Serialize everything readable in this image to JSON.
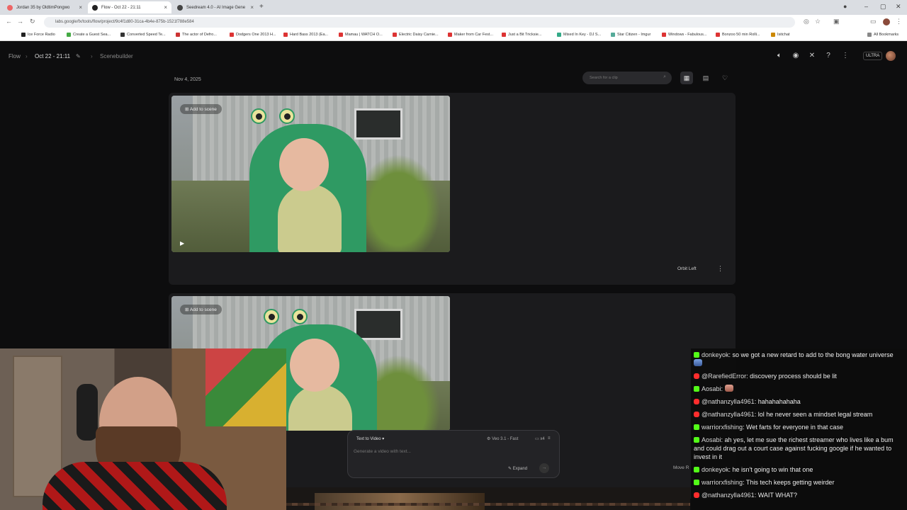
{
  "browser": {
    "tabs": [
      {
        "label": "Jordan 35 by OldtimPongwo"
      },
      {
        "label": "Flow - Oct 22 - 21:11"
      },
      {
        "label": "Seedream 4.0 - AI Image Gene"
      }
    ],
    "url": "labs.google/fx/tools/flow/project/9c4f1d80-31ca-4b4e-875b-1521f788e584",
    "bookmarks": [
      "Ice Force Radio",
      "Create a Guest Sea...",
      "Converted Speed Te...",
      "The actor of Defro...",
      "Dodgers One 2013 H...",
      "Hard Bass 2013 (Ea...",
      "Mamau | WATCH O...",
      "Electric Daisy Carnie...",
      "Maker from Car Fest...",
      "Just a Bit Tricksie...",
      "Mixed In Key - DJ S...",
      "Star Citizen - Imgur",
      "Windows - Fabulous...",
      "Bonzoo 50 min Rolli...",
      "Isitchat",
      "All Bookmarks"
    ]
  },
  "app": {
    "breadcrumb": {
      "root": "Flow",
      "project": "Oct 22 - 21:11",
      "page": "Scenebuilder"
    },
    "badge": "ULTRA",
    "date": "Nov 4, 2025",
    "search_placeholder": "Search for a clip",
    "icons": [
      "volume-icon",
      "discord-icon",
      "x-icon",
      "help-icon",
      "more-vert-icon",
      "grid-view-icon",
      "list-view-icon",
      "favorites-icon"
    ]
  },
  "clips": [
    {
      "add_label": "Add to scene",
      "label": "Orbit Left"
    },
    {
      "add_label": "Add to scene",
      "label": "Move R"
    }
  ],
  "prompt": {
    "mode": "Text to Video",
    "model": "Veo 3.1 - Fast",
    "count": "x4",
    "placeholder": "Generate a video with text...",
    "expand_label": "Expand"
  },
  "chat": {
    "messages": [
      {
        "platform": "kick",
        "user": "donkeyok",
        "text": "so we got a new retard to add to the bong water universe",
        "emote": true
      },
      {
        "platform": "youtube",
        "user": "@RarefiedError",
        "text": "discovery process should be lit"
      },
      {
        "platform": "kick",
        "user": "Aosabi",
        "text": "",
        "emote": true
      },
      {
        "platform": "youtube",
        "user": "@nathanzylla4961",
        "text": "hahahahahaha"
      },
      {
        "platform": "youtube",
        "user": "@nathanzylla4961",
        "text": "lol he never seen a mindset legal stream"
      },
      {
        "platform": "kick",
        "user": "warriorxfishing",
        "text": "Wet farts for everyone in that case"
      },
      {
        "platform": "kick",
        "user": "Aosabi",
        "text": "ah yes, let me sue the richest streamer who lives like a bum and could drag out a court case against fucking google if he wanted to invest in it"
      },
      {
        "platform": "kick",
        "user": "donkeyok",
        "text": "he isn't going to win that one"
      },
      {
        "platform": "kick",
        "user": "warriorxfishing",
        "text": "This tech keeps getting weirder"
      },
      {
        "platform": "youtube",
        "user": "@nathanzylla4961",
        "text": "WAIT WHAT?"
      }
    ]
  }
}
